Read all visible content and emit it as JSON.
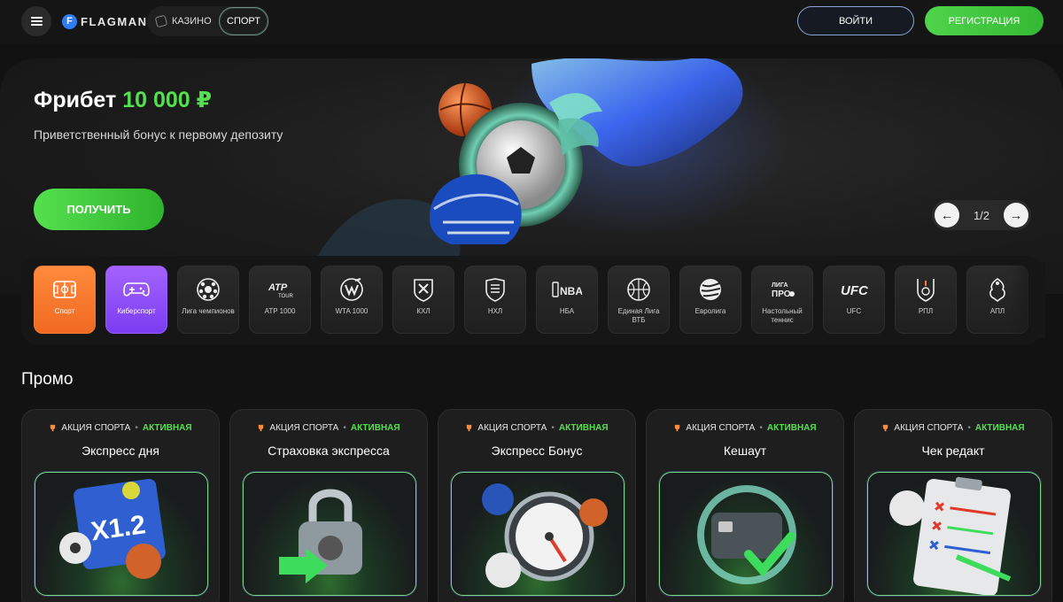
{
  "header": {
    "logo_letter": "F",
    "logo_text": "FLAGMAN",
    "nav_casino": "КАЗИНО",
    "nav_sport": "СПОРТ",
    "login": "ВОЙТИ",
    "register": "РЕГИСТРАЦИЯ"
  },
  "hero": {
    "title": "Фрибет",
    "amount": "10 000 ₽",
    "subtitle": "Приветственный бонус к первому депозиту",
    "cta": "ПОЛУЧИТЬ",
    "counter": "1/2",
    "prev_icon": "←",
    "next_icon": "→"
  },
  "categories": [
    {
      "label": "Спорт",
      "icon": "football-field-icon"
    },
    {
      "label": "Киберспорт",
      "icon": "gamepad-icon"
    },
    {
      "label": "Лига чемпионов",
      "icon": "champions-league-icon"
    },
    {
      "label": "ATP 1000",
      "icon": "atp-tour-icon"
    },
    {
      "label": "WTA 1000",
      "icon": "wta-icon"
    },
    {
      "label": "КХЛ",
      "icon": "khl-icon"
    },
    {
      "label": "НХЛ",
      "icon": "nhl-icon"
    },
    {
      "label": "НБА",
      "icon": "nba-icon"
    },
    {
      "label": "Единая Лига ВТБ",
      "icon": "vtb-league-icon"
    },
    {
      "label": "Евролига",
      "icon": "euroleague-icon"
    },
    {
      "label": "Настольный теннис",
      "icon": "table-tennis-icon"
    },
    {
      "label": "UFC",
      "icon": "ufc-icon"
    },
    {
      "label": "РПЛ",
      "icon": "rpl-icon"
    },
    {
      "label": "АПЛ",
      "icon": "apl-icon"
    }
  ],
  "icon_text": {
    "atp": "ATP",
    "atp_sub": "TOUR",
    "nba": "NBA",
    "ufc": "UFC",
    "liga": "ЛИГА",
    "pro": "ПРО",
    "x12": "X1.2"
  },
  "promo": {
    "title": "Промо",
    "type_label": "АКЦИЯ СПОРТА",
    "status": "АКТИВНАЯ",
    "cards": [
      {
        "name": "Экспресс дня"
      },
      {
        "name": "Страховка экспресса"
      },
      {
        "name": "Экспресс Бонус"
      },
      {
        "name": "Кешаут"
      },
      {
        "name": "Чек редакт"
      }
    ]
  },
  "colors": {
    "accent_green": "#55e04f",
    "sport_orange": "#f07a33",
    "cyber_purple": "#9a58ff",
    "login_border": "#8aa6d8"
  }
}
